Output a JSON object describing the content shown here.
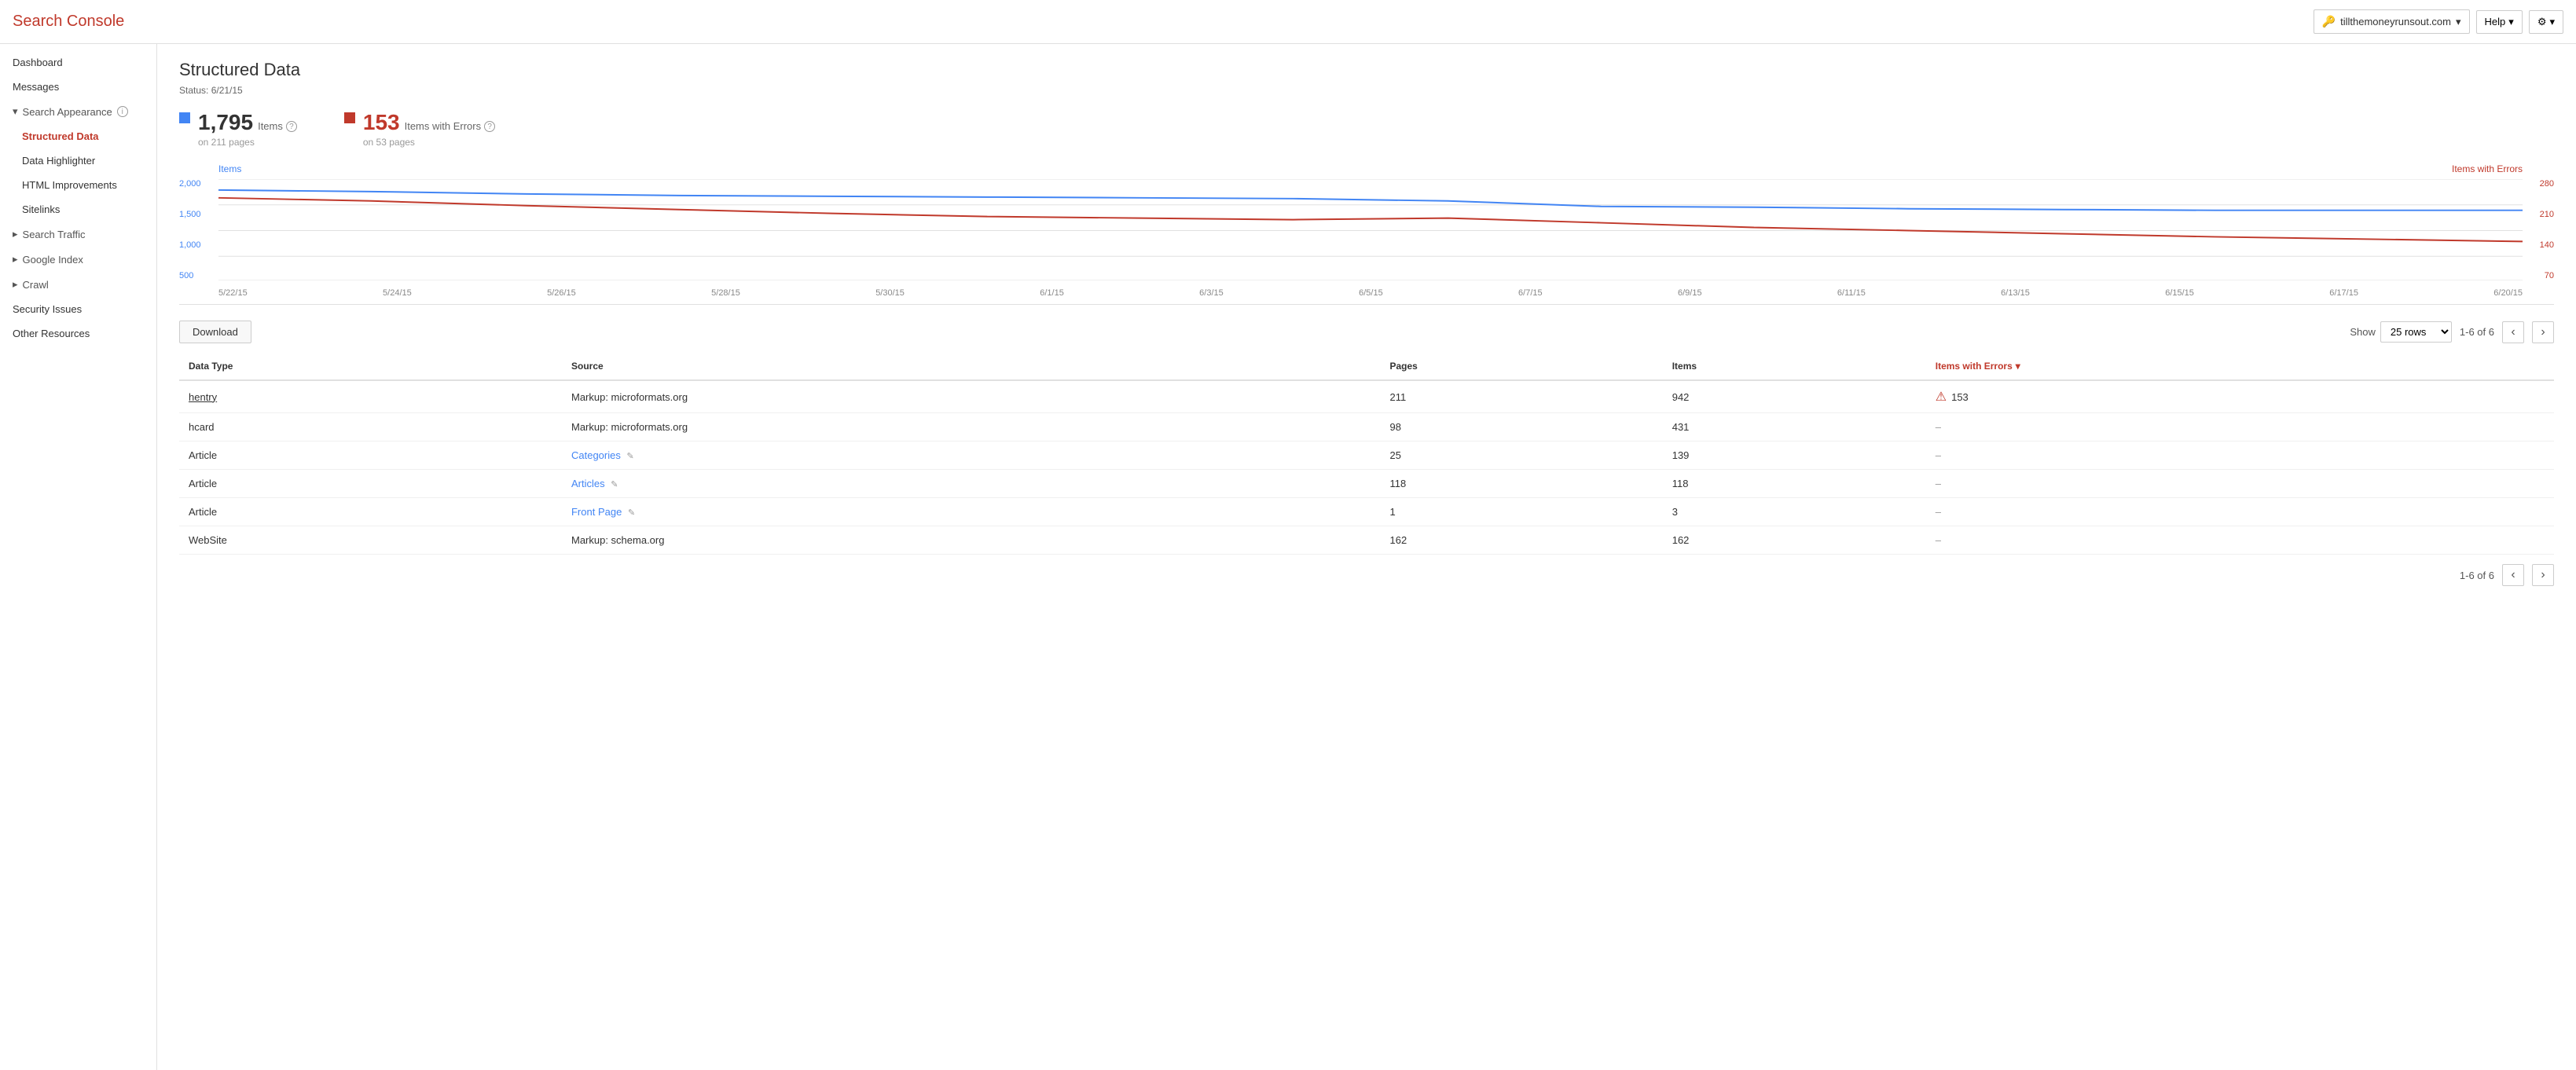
{
  "header": {
    "title": "Search Console",
    "domain": "tillthemoneyrunsout.com",
    "domain_icon": "🔑",
    "help_label": "Help",
    "settings_icon": "⚙"
  },
  "sidebar": {
    "items": [
      {
        "id": "dashboard",
        "label": "Dashboard",
        "indent": 0,
        "active": false
      },
      {
        "id": "messages",
        "label": "Messages",
        "indent": 0,
        "active": false
      },
      {
        "id": "search-appearance",
        "label": "Search Appearance",
        "indent": 0,
        "active": false,
        "expandable": true,
        "expanded": true,
        "info": true
      },
      {
        "id": "structured-data",
        "label": "Structured Data",
        "indent": 1,
        "active": true
      },
      {
        "id": "data-highlighter",
        "label": "Data Highlighter",
        "indent": 1,
        "active": false
      },
      {
        "id": "html-improvements",
        "label": "HTML Improvements",
        "indent": 1,
        "active": false
      },
      {
        "id": "sitelinks",
        "label": "Sitelinks",
        "indent": 1,
        "active": false
      },
      {
        "id": "search-traffic",
        "label": "Search Traffic",
        "indent": 0,
        "active": false,
        "expandable": true
      },
      {
        "id": "google-index",
        "label": "Google Index",
        "indent": 0,
        "active": false,
        "expandable": true
      },
      {
        "id": "crawl",
        "label": "Crawl",
        "indent": 0,
        "active": false,
        "expandable": true
      },
      {
        "id": "security-issues",
        "label": "Security Issues",
        "indent": 0,
        "active": false
      },
      {
        "id": "other-resources",
        "label": "Other Resources",
        "indent": 0,
        "active": false
      }
    ]
  },
  "page": {
    "title": "Structured Data",
    "status": "Status: 6/21/15",
    "items_count": "1,795",
    "items_label": "Items",
    "items_pages": "on 211 pages",
    "errors_count": "153",
    "errors_label": "Items with Errors",
    "errors_pages": "on 53 pages"
  },
  "chart": {
    "legend_left": "Items",
    "legend_right": "Items with Errors",
    "y_labels_left": [
      "2,000",
      "1,500",
      "1,000",
      "500"
    ],
    "y_labels_right": [
      "280",
      "210",
      "140",
      "70"
    ],
    "x_labels": [
      "5/22/15",
      "5/24/15",
      "5/26/15",
      "5/28/15",
      "5/30/15",
      "6/1/15",
      "6/3/15",
      "6/5/15",
      "6/7/15",
      "6/9/15",
      "6/11/15",
      "6/13/15",
      "6/15/15",
      "6/17/15",
      "6/20/15"
    ]
  },
  "toolbar": {
    "download_label": "Download",
    "show_label": "Show",
    "rows_option": "25 rows",
    "pagination": "1-6 of 6"
  },
  "table": {
    "columns": [
      "Data Type",
      "Source",
      "Pages",
      "Items",
      "Items with Errors"
    ],
    "rows": [
      {
        "data_type": "hentry",
        "data_type_link": true,
        "source": "Markup: microformats.org",
        "source_link": false,
        "pages": "211",
        "items": "942",
        "errors": "153",
        "has_error": true
      },
      {
        "data_type": "hcard",
        "data_type_link": false,
        "source": "Markup: microformats.org",
        "source_link": false,
        "pages": "98",
        "items": "431",
        "errors": "–",
        "has_error": false
      },
      {
        "data_type": "Article",
        "data_type_link": false,
        "source": "Categories",
        "source_link": true,
        "source_edit": true,
        "pages": "25",
        "items": "139",
        "errors": "–",
        "has_error": false
      },
      {
        "data_type": "Article",
        "data_type_link": false,
        "source": "Articles",
        "source_link": true,
        "source_edit": true,
        "pages": "118",
        "items": "118",
        "errors": "–",
        "has_error": false
      },
      {
        "data_type": "Article",
        "data_type_link": false,
        "source": "Front Page",
        "source_link": true,
        "source_edit": true,
        "pages": "1",
        "items": "3",
        "errors": "–",
        "has_error": false
      },
      {
        "data_type": "WebSite",
        "data_type_link": false,
        "source": "Markup: schema.org",
        "source_link": false,
        "pages": "162",
        "items": "162",
        "errors": "–",
        "has_error": false
      }
    ]
  },
  "bottom_pagination": "1-6 of 6"
}
